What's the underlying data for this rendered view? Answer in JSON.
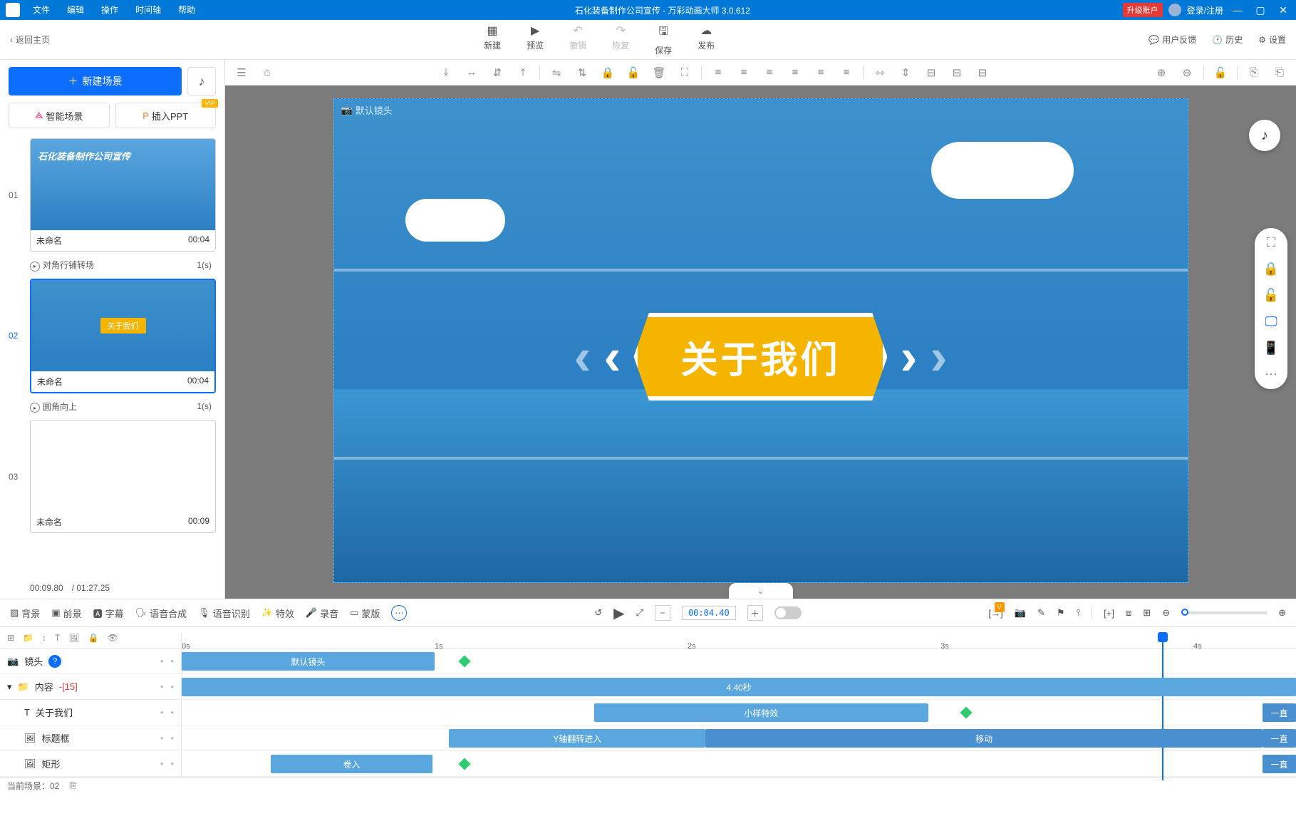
{
  "app": {
    "title": "石化装备制作公司宣传 - 万彩动画大师 3.0.612",
    "upgrade": "升级账户",
    "login": "登录/注册"
  },
  "menu": {
    "file": "文件",
    "edit": "编辑",
    "operate": "操作",
    "timeline": "时间轴",
    "help": "帮助"
  },
  "back": "返回主页",
  "topActions": {
    "new": "新建",
    "preview": "预览",
    "undo": "撤销",
    "redo": "恢复",
    "save": "保存",
    "publish": "发布"
  },
  "topRight": {
    "feedback": "用户反馈",
    "history": "历史",
    "settings": "设置"
  },
  "left": {
    "newScene": "新建场景",
    "aiScene": "智能场景",
    "insertPPT": "插入PPT",
    "vip": "VIP",
    "trans1": "对角行铺转场",
    "trans1dur": "1(s)",
    "trans2": "圆角向上",
    "trans2dur": "1(s)",
    "untitled": "未命名",
    "s1dur": "00:04",
    "s2dur": "00:04",
    "s3dur": "00:09",
    "curTime": "00:09.80",
    "totTime": "/ 01:27.25",
    "thumb1Title": "石化装备制作公司宣传",
    "thumb2About": "关于我们"
  },
  "canvas": {
    "camLabel": "默认镜头",
    "aboutUs": "关于我们"
  },
  "btool": {
    "bg": "背景",
    "fg": "前景",
    "subtitle": "字幕",
    "tts": "语音合成",
    "asr": "语音识别",
    "fx": "特效",
    "record": "录音",
    "mask": "蒙版",
    "timecode": "00:04.40"
  },
  "ruler": {
    "t0": "0s",
    "t1": "1s",
    "t2": "2s",
    "t3": "3s",
    "t4": "4s"
  },
  "tracks": {
    "camera": "镜头",
    "cameraClip": "默认镜头",
    "content": "内容",
    "contentCount": "-[15]",
    "contentClip": "4.40秒",
    "text": "关于我们",
    "textClip": "小样特效",
    "textTail": "一直",
    "titleFrame": "标题框",
    "titleClip1": "Y轴翻转进入",
    "titleClip2": "移动",
    "titleTail": "一直",
    "rect": "矩形",
    "rectClip": "卷入",
    "rectTail": "一直"
  },
  "status": {
    "curScene": "当前场景：02"
  },
  "icons": {
    "plus": "＋",
    "note": "♪",
    "back": "‹",
    "new": "▤",
    "play": "▶",
    "undo": "↶",
    "redo": "↷",
    "save": "🖫",
    "publish": "☁",
    "chat": "💬",
    "clock": "🕑",
    "gear": "⚙",
    "chevDown": "⌄",
    "chevL": "‹",
    "chevR": "›",
    "help": "?",
    "diamond": "◆",
    "folder": "📁",
    "text": "T",
    "image": "🖼",
    "camera": "📷",
    "minus": "−",
    "add": "＋",
    "lock": "🔒",
    "unlock": "🔓",
    "fullscreen": "⛶",
    "más": "⋯",
    "zoomIn": "⊕",
    "zoomOut": "⊖"
  }
}
